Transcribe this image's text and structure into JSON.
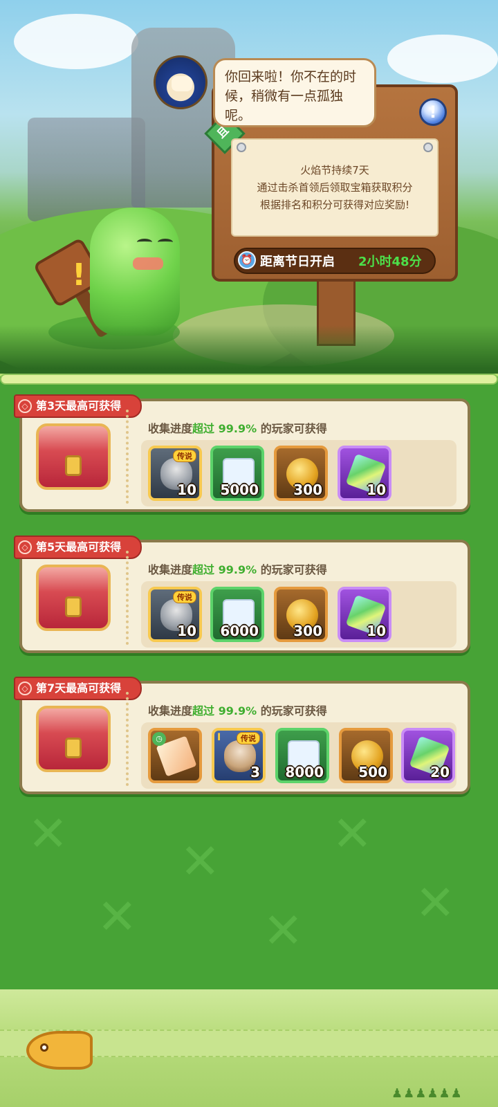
{
  "npc": {
    "speech": "你回来啦！你不在的时候，稍微有一点孤独呢。"
  },
  "sign": {
    "tag": "且",
    "lines": [
      "火焰节持续7天",
      "通过击杀首领后领取宝箱获取积分",
      "根据排名和积分可获得对应奖励!"
    ],
    "timer_label": "距离节日开启",
    "timer_value": "2小时48分",
    "info_icon": "exclamation-icon"
  },
  "rewards": [
    {
      "ribbon": "第3天最高可获得",
      "progress_prefix": "收集进度",
      "progress_highlight": "超过",
      "progress_value": "99.9%",
      "progress_suffix": "的玩家可获得",
      "items": [
        {
          "type": "hero",
          "tag": "传说",
          "count": "10"
        },
        {
          "type": "scroll",
          "count": "5000"
        },
        {
          "type": "coin",
          "count": "300"
        },
        {
          "type": "gem",
          "count": "10"
        }
      ]
    },
    {
      "ribbon": "第5天最高可获得",
      "progress_prefix": "收集进度",
      "progress_highlight": "超过",
      "progress_value": "99.9%",
      "progress_suffix": "的玩家可获得",
      "items": [
        {
          "type": "hero",
          "tag": "传说",
          "count": "10"
        },
        {
          "type": "scroll",
          "count": "6000"
        },
        {
          "type": "coin",
          "count": "300"
        },
        {
          "type": "gem",
          "count": "10"
        }
      ]
    },
    {
      "ribbon": "第7天最高可获得",
      "progress_prefix": "收集进度",
      "progress_highlight": "超过",
      "progress_value": "99.9%",
      "progress_suffix": "的玩家可获得",
      "items": [
        {
          "type": "ticket",
          "count": ""
        },
        {
          "type": "hero-portrait",
          "tag": "传说",
          "rank": "I",
          "count": "3"
        },
        {
          "type": "scroll",
          "count": "8000"
        },
        {
          "type": "coin",
          "count": "500"
        },
        {
          "type": "gem",
          "count": "20"
        }
      ]
    }
  ],
  "colors": {
    "panel_green": "#47a336",
    "ribbon_red": "#d8423a",
    "highlight_green": "#3fae2f",
    "timer_green": "#4de04a"
  }
}
